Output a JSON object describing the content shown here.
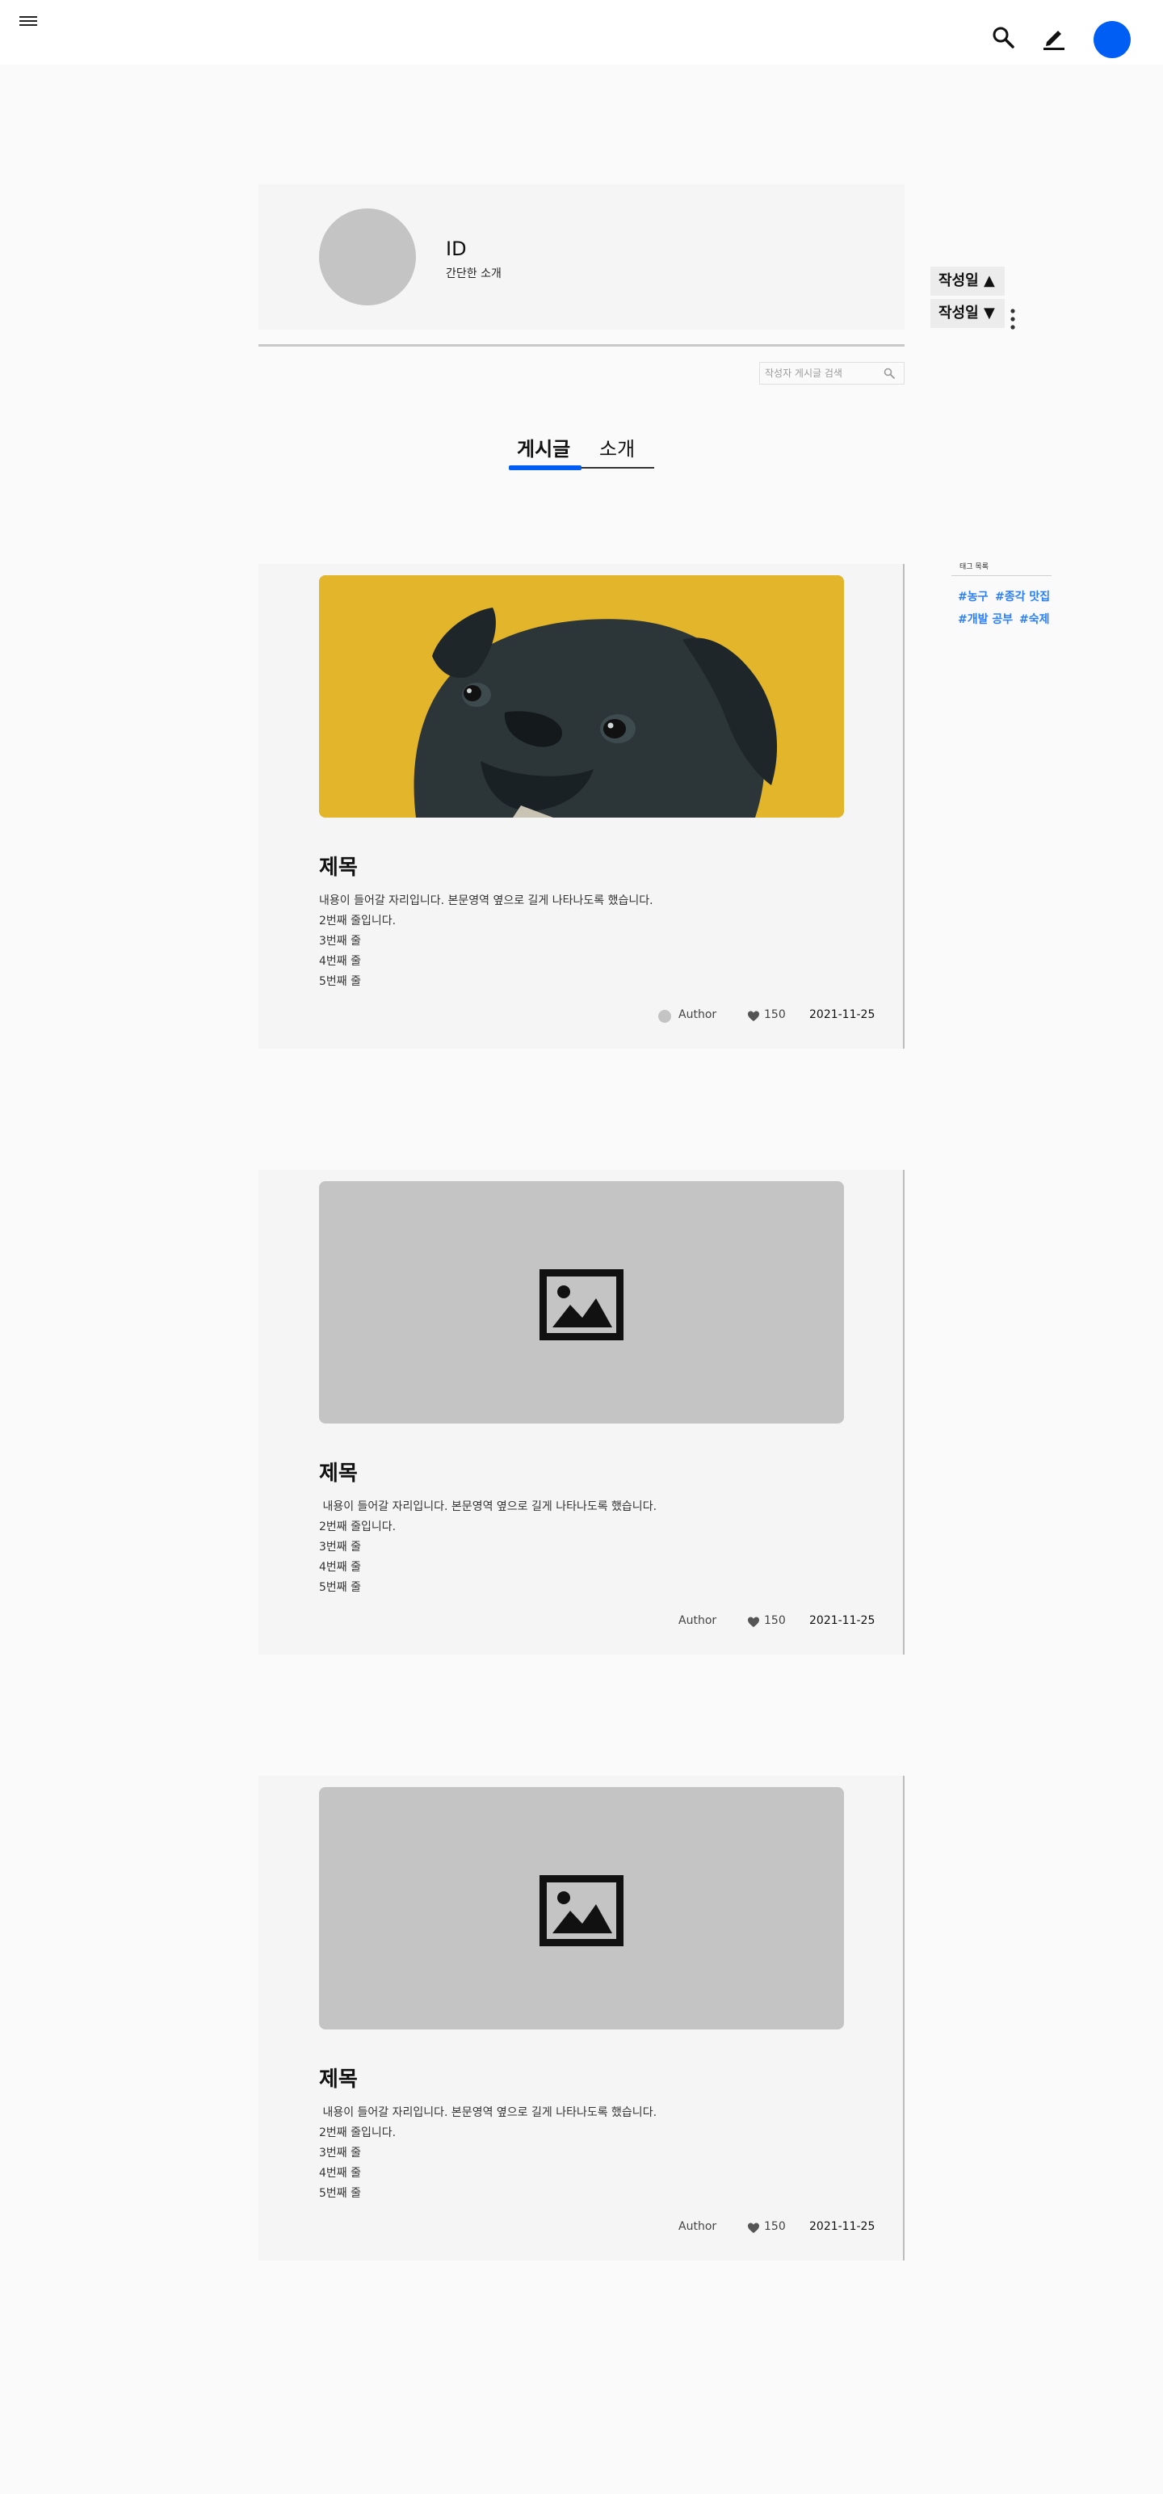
{
  "header": {
    "menu_icon": "hamburger-menu-icon",
    "search_icon": "search-icon",
    "edit_icon": "pencil-icon",
    "avatar_color": "#005ef5"
  },
  "profile": {
    "id": "ID",
    "bio": "간단한 소개"
  },
  "sort": {
    "asc_label": "작성일 ▲",
    "desc_label": "작성일 ▼",
    "more_icon": "kebab-menu-icon"
  },
  "search": {
    "placeholder": "작성자 게시글 검색",
    "icon": "search-icon"
  },
  "tabs": [
    {
      "label": "게시글",
      "active": true
    },
    {
      "label": "소개",
      "active": false
    }
  ],
  "tag_box": {
    "title": "태그 목록",
    "tags": [
      "#농구",
      "#종각 맛집",
      "#개발 공부",
      "#숙제"
    ],
    "tag_color": "#2a7fff"
  },
  "posts": [
    {
      "image": "pug-photo",
      "title": "제목",
      "lines": [
        "내용이 들어갈 자리입니다. 본문영역 옆으로 길게 나타나도록 했습니다.",
        "2번째 줄입니다.",
        "3번째 줄",
        "4번째 줄",
        "5번째 줄"
      ],
      "author": "Author",
      "likes": "150",
      "date": "2021-11-25"
    },
    {
      "image": "image-placeholder-icon",
      "title": "제목",
      "lines": [
        " 내용이 들어갈 자리입니다. 본문영역 옆으로 길게 나타나도록 했습니다.",
        "2번째 줄입니다.",
        "3번째 줄",
        "4번째 줄",
        "5번째 줄"
      ],
      "author": "Author",
      "likes": "150",
      "date": "2021-11-25"
    },
    {
      "image": "image-placeholder-icon",
      "title": "제목",
      "lines": [
        " 내용이 들어갈 자리입니다. 본문영역 옆으로 길게 나타나도록 했습니다.",
        "2번째 줄입니다.",
        "3번째 줄",
        "4번째 줄",
        "5번째 줄"
      ],
      "author": "Author",
      "likes": "150",
      "date": "2021-11-25"
    }
  ]
}
